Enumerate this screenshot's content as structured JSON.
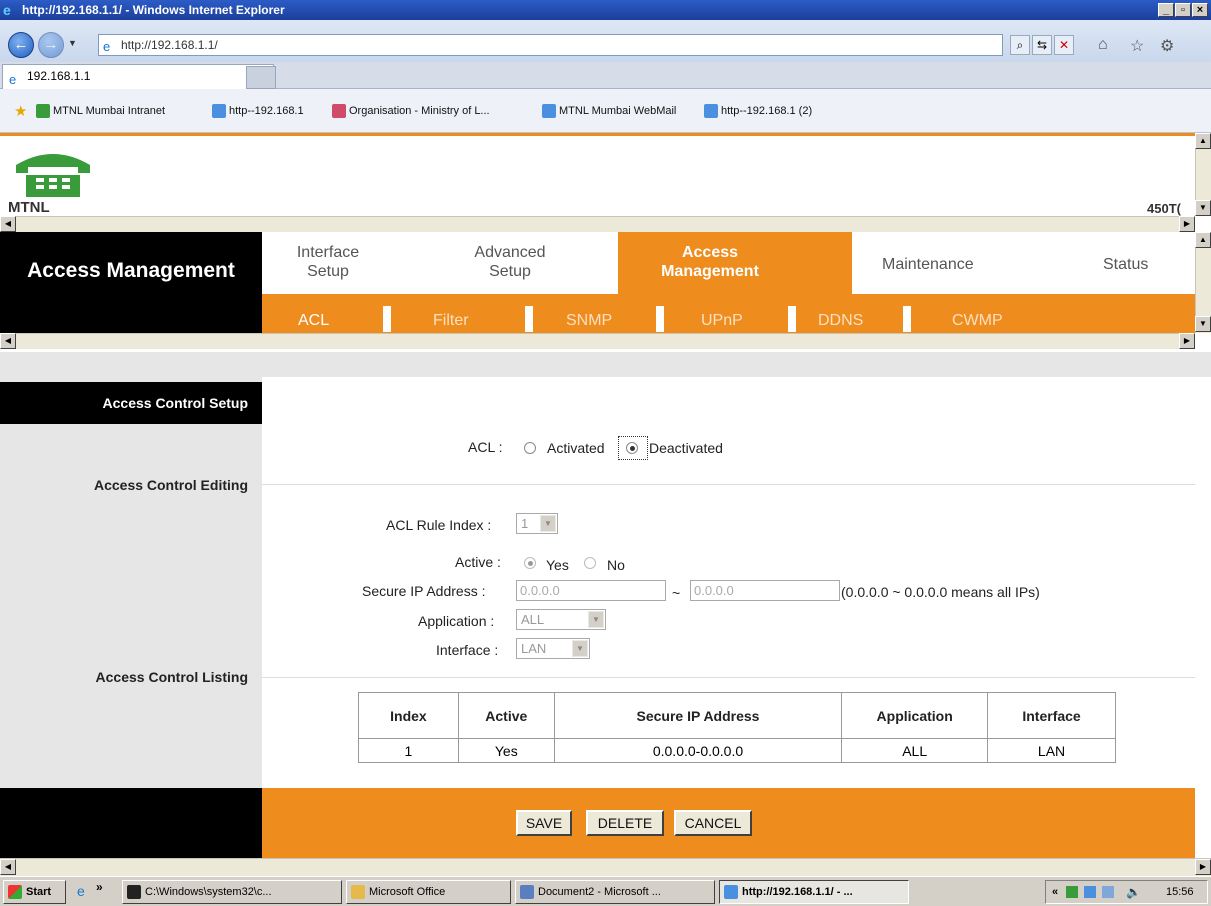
{
  "window": {
    "title": "http://192.168.1.1/ - Windows Internet Explorer"
  },
  "browser": {
    "url": "http://192.168.1.1/",
    "tab_title": "192.168.1.1",
    "favorites": [
      "MTNL Mumbai Intranet",
      "http--192.168.1",
      "Organisation - Ministry of L...",
      "MTNL Mumbai WebMail",
      "http--192.168.1 (2)"
    ]
  },
  "banner": {
    "brand": "MTNL",
    "model": "450T("
  },
  "nav": {
    "section_title": "Access Management",
    "tabs": [
      {
        "label_1": "Interface",
        "label_2": "Setup"
      },
      {
        "label_1": "Advanced",
        "label_2": "Setup"
      },
      {
        "label_1": "Access",
        "label_2": "Management"
      },
      {
        "label": "Maintenance"
      },
      {
        "label": "Status"
      }
    ],
    "subtabs": [
      "ACL",
      "Filter",
      "SNMP",
      "UPnP",
      "DDNS",
      "CWMP"
    ]
  },
  "left": {
    "header": "Access Control Setup",
    "editing": "Access Control Editing",
    "listing": "Access Control Listing"
  },
  "form": {
    "acl_label": "ACL :",
    "activated": "Activated",
    "deactivated": "Deactivated",
    "acl_selected": "Deactivated",
    "rule_index_label": "ACL Rule Index :",
    "rule_index_value": "1",
    "active_label": "Active :",
    "yes": "Yes",
    "no": "No",
    "active_selected": "Yes",
    "secure_ip_label": "Secure IP Address :",
    "ip_start": "0.0.0.0",
    "tilde": "~",
    "ip_end": "0.0.0.0",
    "ip_note": "(0.0.0.0 ~ 0.0.0.0 means all IPs)",
    "application_label": "Application :",
    "application_value": "ALL",
    "interface_label": "Interface :",
    "interface_value": "LAN"
  },
  "table": {
    "headers": [
      "Index",
      "Active",
      "Secure IP Address",
      "Application",
      "Interface"
    ],
    "rows": [
      [
        "1",
        "Yes",
        "0.0.0.0-0.0.0.0",
        "ALL",
        "LAN"
      ]
    ]
  },
  "buttons": {
    "save": "SAVE",
    "delete": "DELETE",
    "cancel": "CANCEL"
  },
  "taskbar": {
    "start": "Start",
    "chevron": "»",
    "items": [
      "C:\\Windows\\system32\\c...",
      "Microsoft Office",
      "Document2 - Microsoft ...",
      "http://192.168.1.1/ - ..."
    ],
    "tray_chevron": "«",
    "time": "15:56"
  },
  "colors": {
    "accent": "#ef8c1e",
    "title_bar": "#1b3f9c"
  }
}
